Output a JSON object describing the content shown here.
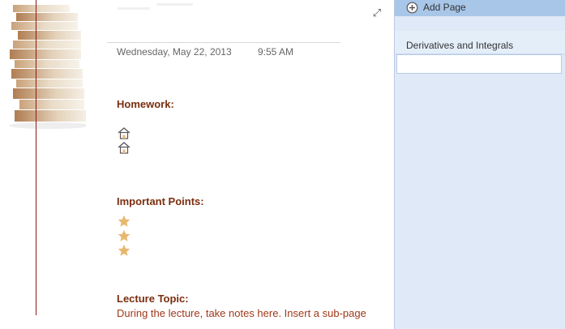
{
  "note": {
    "date": "Wednesday, May 22, 2013",
    "time": "9:55 AM",
    "sections": [
      {
        "heading": "Homework:",
        "bullet_icon": "home-icon",
        "bullet_count": 2
      },
      {
        "heading": "Important Points:",
        "bullet_icon": "star-icon",
        "bullet_count": 3
      },
      {
        "heading": "Lecture Topic:",
        "text": "During the lecture, take notes here.  Insert a sub-page"
      }
    ]
  },
  "sidebar": {
    "add_page_label": "Add Page",
    "pages": [
      {
        "label": "Derivatives and Integrals"
      }
    ]
  },
  "colors": {
    "heading": "#7a2e0e",
    "body_text": "#a0381a",
    "margin_line": "#8b1a1a",
    "sidebar_bg": "#dfe9f7",
    "add_page_bg": "#a8c6e8",
    "star": "#e8b870"
  },
  "icons": {
    "expand": "expand-icon",
    "add": "plus-circle-icon",
    "books": "book-stack-icon"
  }
}
